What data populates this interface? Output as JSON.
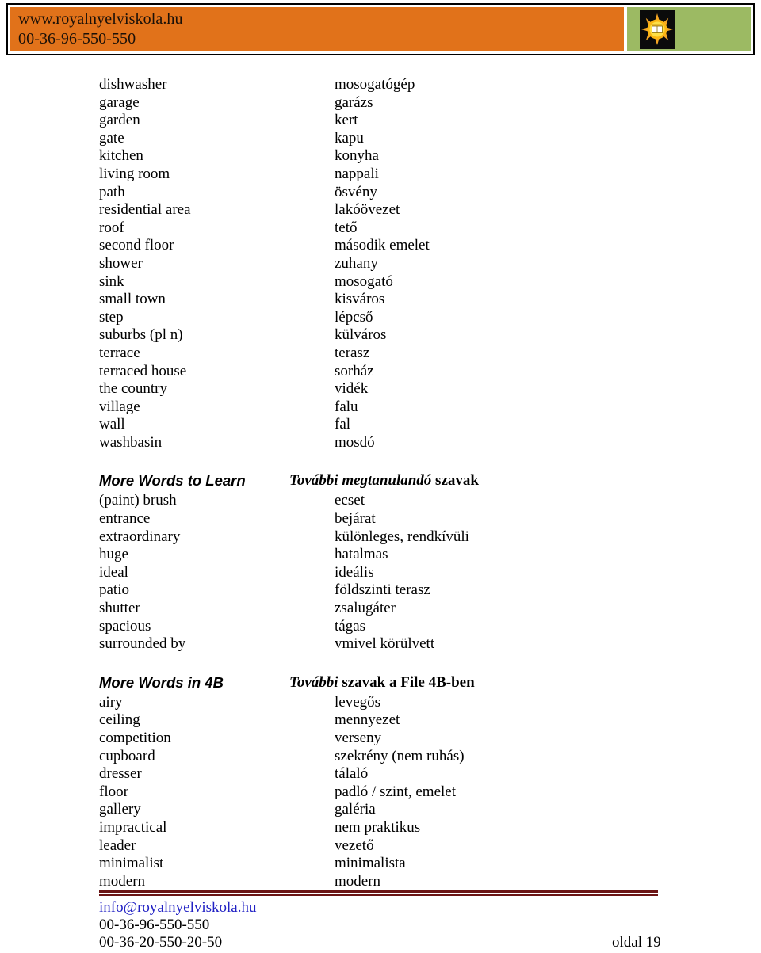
{
  "header": {
    "website": "www.royalnyelviskola.hu",
    "phone": "00-36-96-550-550",
    "logo_icon": "sun-book-logo-icon",
    "orange_color": "#e1721a",
    "green_color": "#9cba63"
  },
  "sections": [
    {
      "id": "main-vocabulary",
      "heading_en": "",
      "heading_hu_italic": "",
      "heading_hu_rest": "",
      "entries": [
        {
          "term": "dishwasher",
          "translation": "mosogatógép"
        },
        {
          "term": "garage",
          "translation": "garázs"
        },
        {
          "term": "garden",
          "translation": "kert"
        },
        {
          "term": "gate",
          "translation": "kapu"
        },
        {
          "term": "kitchen",
          "translation": "konyha"
        },
        {
          "term": "living room",
          "translation": "nappali"
        },
        {
          "term": "path",
          "translation": "ösvény"
        },
        {
          "term": "residential area",
          "translation": "lakóövezet"
        },
        {
          "term": "roof",
          "translation": "tető"
        },
        {
          "term": "second floor",
          "translation": "második emelet"
        },
        {
          "term": "shower",
          "translation": "zuhany"
        },
        {
          "term": "sink",
          "translation": "mosogató"
        },
        {
          "term": "small town",
          "translation": "kisváros"
        },
        {
          "term": "step",
          "translation": "lépcső"
        },
        {
          "term": "suburbs (pl n)",
          "translation": "külváros"
        },
        {
          "term": "terrace",
          "translation": "terasz"
        },
        {
          "term": "terraced house",
          "translation": "sorház"
        },
        {
          "term": "the country",
          "translation": "vidék"
        },
        {
          "term": "village",
          "translation": "falu"
        },
        {
          "term": "wall",
          "translation": "fal"
        },
        {
          "term": "washbasin",
          "translation": "mosdó"
        }
      ]
    },
    {
      "id": "more-words-to-learn",
      "heading_en": "More Words to Learn",
      "heading_hu_italic": "További megtanulandó ",
      "heading_hu_rest": "szavak",
      "entries": [
        {
          "term": "(paint) brush",
          "translation": "ecset"
        },
        {
          "term": "entrance",
          "translation": "bejárat"
        },
        {
          "term": "extraordinary",
          "translation": "különleges, rendkívüli"
        },
        {
          "term": "huge",
          "translation": "hatalmas"
        },
        {
          "term": "ideal",
          "translation": "ideális"
        },
        {
          "term": "patio",
          "translation": "földszinti terasz"
        },
        {
          "term": "shutter",
          "translation": "zsalugáter"
        },
        {
          "term": "spacious",
          "translation": "tágas"
        },
        {
          "term": "surrounded by",
          "translation": "vmivel körülvett"
        }
      ]
    },
    {
      "id": "more-words-in-4b",
      "heading_en": "More Words in 4B",
      "heading_hu_italic": "További ",
      "heading_hu_rest": "szavak a File 4B-ben",
      "entries": [
        {
          "term": "airy",
          "translation": "levegős"
        },
        {
          "term": "ceiling",
          "translation": "mennyezet"
        },
        {
          "term": "competition",
          "translation": "verseny"
        },
        {
          "term": "cupboard",
          "translation": "szekrény (nem ruhás)"
        },
        {
          "term": "dresser",
          "translation": "tálaló"
        },
        {
          "term": "floor",
          "translation": "padló / szint, emelet"
        },
        {
          "term": "gallery",
          "translation": "galéria"
        },
        {
          "term": "impractical",
          "translation": "nem praktikus"
        },
        {
          "term": "leader",
          "translation": "vezető"
        },
        {
          "term": "minimalist",
          "translation": "minimalista"
        },
        {
          "term": "modern",
          "translation": "modern"
        }
      ]
    }
  ],
  "footer": {
    "email": "info@royalnyelviskola.hu",
    "phone1": "00-36-96-550-550",
    "phone2": "00-36-20-550-20-50",
    "page_label": "oldal 19",
    "rule_color": "#6b1414",
    "link_color": "#2121c4"
  }
}
